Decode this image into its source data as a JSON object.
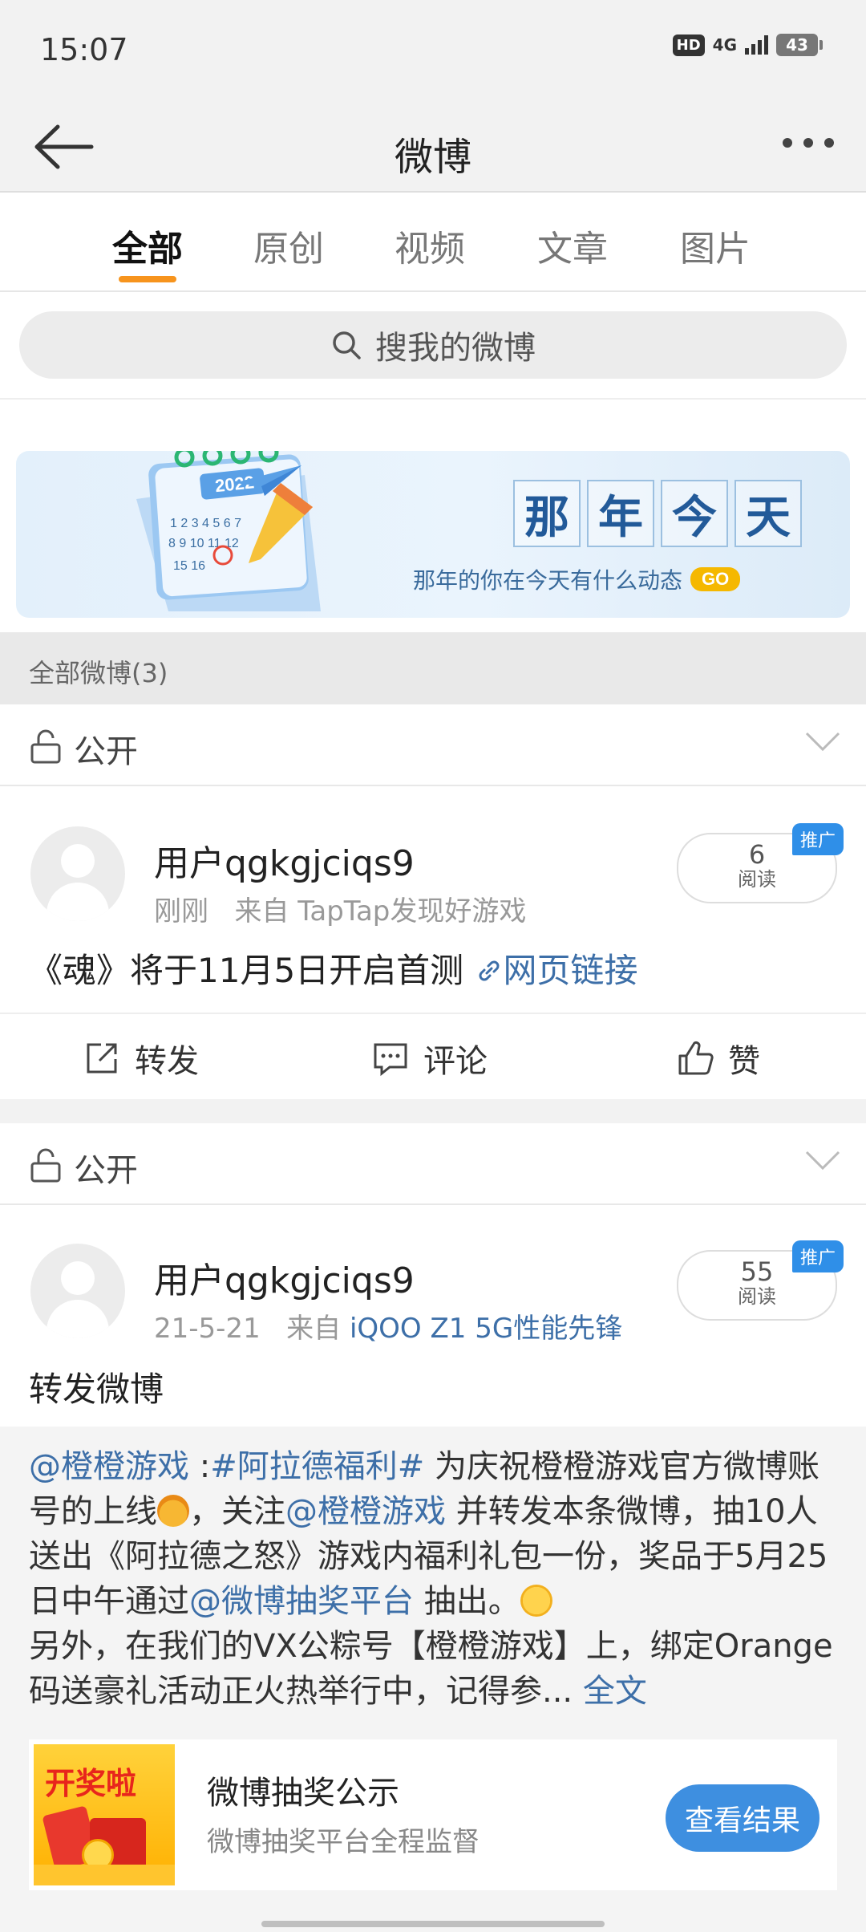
{
  "status": {
    "time": "15:07",
    "hd": "HD",
    "network": "4G",
    "battery": "43"
  },
  "header": {
    "title": "微博",
    "back_icon": "arrow-left-icon",
    "more_icon": "more-dots-icon"
  },
  "tabs": [
    {
      "label": "全部",
      "active": true
    },
    {
      "label": "原创",
      "active": false
    },
    {
      "label": "视频",
      "active": false
    },
    {
      "label": "文章",
      "active": false
    },
    {
      "label": "图片",
      "active": false
    }
  ],
  "search": {
    "placeholder": "搜我的微博"
  },
  "banner": {
    "calendar_year": "2022",
    "title_chars": [
      "那",
      "年",
      "今",
      "天"
    ],
    "subtitle": "那年的你在今天有什么动态",
    "go": "GO"
  },
  "section": {
    "title": "全部微博(3)"
  },
  "posts": [
    {
      "privacy": "公开",
      "username": "用户qgkgjciqs9",
      "time": "刚刚",
      "source_prefix": "来自",
      "source": "TapTap发现好游戏",
      "reads": "6",
      "reads_label": "阅读",
      "promo": "推广",
      "text": "《魂》将于11月5日开启首测",
      "link_text": "网页链接",
      "actions": {
        "repost": "转发",
        "comment": "评论",
        "like": "赞"
      }
    },
    {
      "privacy": "公开",
      "username": "用户qgkgjciqs9",
      "time": "21-5-21",
      "source_prefix": "来自",
      "source": "iQOO Z1 5G性能先锋",
      "reads": "55",
      "reads_label": "阅读",
      "promo": "推广",
      "text": "转发微博",
      "quote": {
        "mention1": "@橙橙游戏",
        "colon": " :",
        "tag": "#阿拉德福利#",
        "seg1": " 为庆祝橙橙游戏官方微博账号的上线",
        "seg2": "，关注",
        "mention2": "@橙橙游戏",
        "seg3": " 并转发本条微博，抽10人送出《阿拉德之怒》游戏内福利礼包一份，奖品于5月25日中午通过",
        "mention3": "@微博抽奖平台",
        "seg4": " 抽出。",
        "seg5": "另外，在我们的VX公粽号【橙橙游戏】上，绑定Orange码送豪礼活动正火热举行中，记得参...",
        "full": " 全文"
      },
      "lottery": {
        "image_text": "开奖啦",
        "title": "微博抽奖公示",
        "subtitle": "微博抽奖平台全程监督",
        "button": "查看结果"
      }
    }
  ]
}
